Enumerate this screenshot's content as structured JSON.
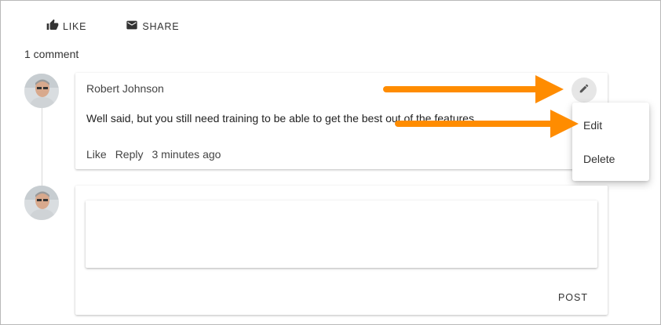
{
  "actions": {
    "like_label": "LIKE",
    "share_label": "SHARE"
  },
  "comments": {
    "count_label": "1 comment"
  },
  "comment": {
    "author": "Robert Johnson",
    "text": "Well said, but you still need training to be able to get the best out of the features",
    "like_label": "Like",
    "reply_label": "Reply",
    "timestamp": "3 minutes ago"
  },
  "menu": {
    "edit_label": "Edit",
    "delete_label": "Delete"
  },
  "reply": {
    "input_value": "",
    "post_label": "POST"
  },
  "colors": {
    "arrow": "#FF8C00",
    "accent_text": "#333333"
  },
  "icons": [
    "thumbs-up-icon",
    "envelope-icon",
    "pencil-icon",
    "avatar"
  ]
}
